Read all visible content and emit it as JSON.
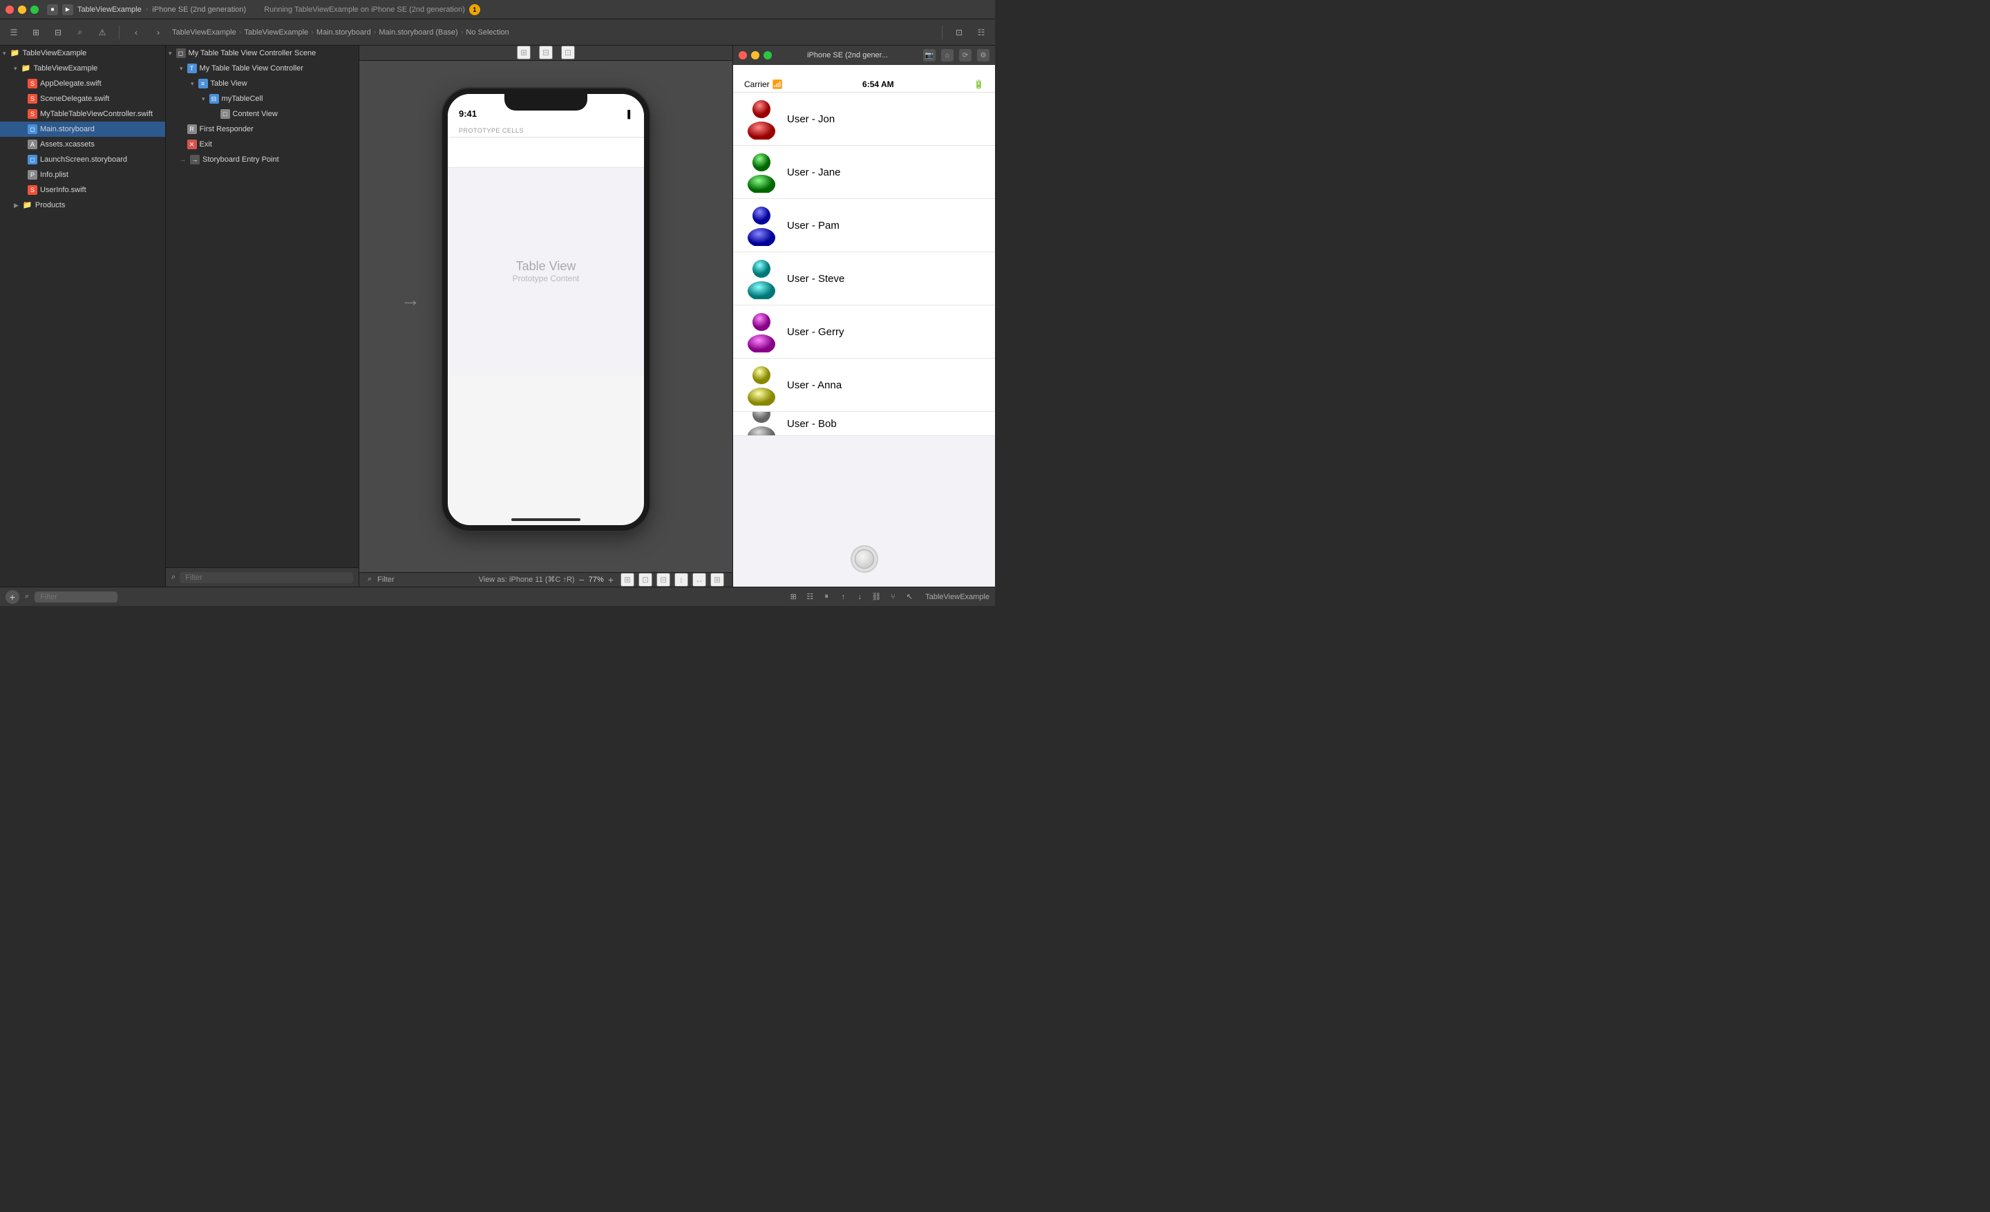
{
  "titlebar": {
    "app_name": "TableViewExample",
    "device": "iPhone SE (2nd generation)",
    "run_text": "Running TableViewExample on iPhone SE (2nd generation)",
    "warning_count": "1"
  },
  "breadcrumb": {
    "parts": [
      "TableViewExample",
      "TableViewExample",
      "Main.storyboard",
      "Main.storyboard (Base)",
      "No Selection"
    ]
  },
  "file_navigator": {
    "root": "TableViewExample",
    "group": "TableViewExample",
    "files": [
      {
        "name": "AppDelegate.swift",
        "type": "swift",
        "indent": 2
      },
      {
        "name": "SceneDelegate.swift",
        "type": "swift",
        "indent": 2
      },
      {
        "name": "MyTableTableViewController.swift",
        "type": "swift",
        "indent": 2
      },
      {
        "name": "Main.storyboard",
        "type": "storyboard",
        "indent": 2,
        "selected": true
      },
      {
        "name": "Assets.xcassets",
        "type": "assets",
        "indent": 2
      },
      {
        "name": "LaunchScreen.storyboard",
        "type": "storyboard",
        "indent": 2
      },
      {
        "name": "Info.plist",
        "type": "plist",
        "indent": 2
      },
      {
        "name": "UserInfo.swift",
        "type": "swift",
        "indent": 2
      }
    ],
    "products": "Products"
  },
  "scene_tree": {
    "items": [
      {
        "name": "My Table Table View Controller Scene",
        "type": "scene",
        "indent": 0
      },
      {
        "name": "My Table Table View Controller",
        "type": "tablevc",
        "indent": 1
      },
      {
        "name": "Table View",
        "type": "tableview",
        "indent": 2
      },
      {
        "name": "myTableCell",
        "type": "cell",
        "indent": 3
      },
      {
        "name": "Content View",
        "type": "contentview",
        "indent": 4
      },
      {
        "name": "First Responder",
        "type": "responder",
        "indent": 1
      },
      {
        "name": "Exit",
        "type": "exit",
        "indent": 1
      },
      {
        "name": "Storyboard Entry Point",
        "type": "entrypoint",
        "indent": 1
      }
    ]
  },
  "canvas": {
    "prototype_cells_label": "PROTOTYPE CELLS",
    "table_view_label": "Table View",
    "table_view_sublabel": "Prototype Content",
    "status_time": "9:41",
    "zoom_level": "77%",
    "view_as_label": "View as: iPhone 11 (⌘C ↑R)"
  },
  "simulator": {
    "title": "iPhone SE (2nd gener...",
    "carrier": "Carrier",
    "time": "6:54 AM",
    "users": [
      {
        "name": "User - Jon",
        "color": "red"
      },
      {
        "name": "User - Jane",
        "color": "green"
      },
      {
        "name": "User - Pam",
        "color": "blue"
      },
      {
        "name": "User - Steve",
        "color": "teal"
      },
      {
        "name": "User - Gerry",
        "color": "magenta"
      },
      {
        "name": "User - Anna",
        "color": "yellow"
      },
      {
        "name": "User - Bob",
        "color": "gray"
      }
    ]
  },
  "toolbar": {
    "filter_label": "Filter",
    "filter_placeholder": "Filter"
  },
  "icons": {
    "folder": "📁",
    "swift": "S",
    "storyboard": "◻",
    "play": "▶",
    "stop": "■",
    "warning": "⚠",
    "search": "⌕",
    "plus": "+",
    "minus": "−",
    "chevron_right": "›",
    "chevron_down": "▾",
    "arrow_right": "→"
  }
}
